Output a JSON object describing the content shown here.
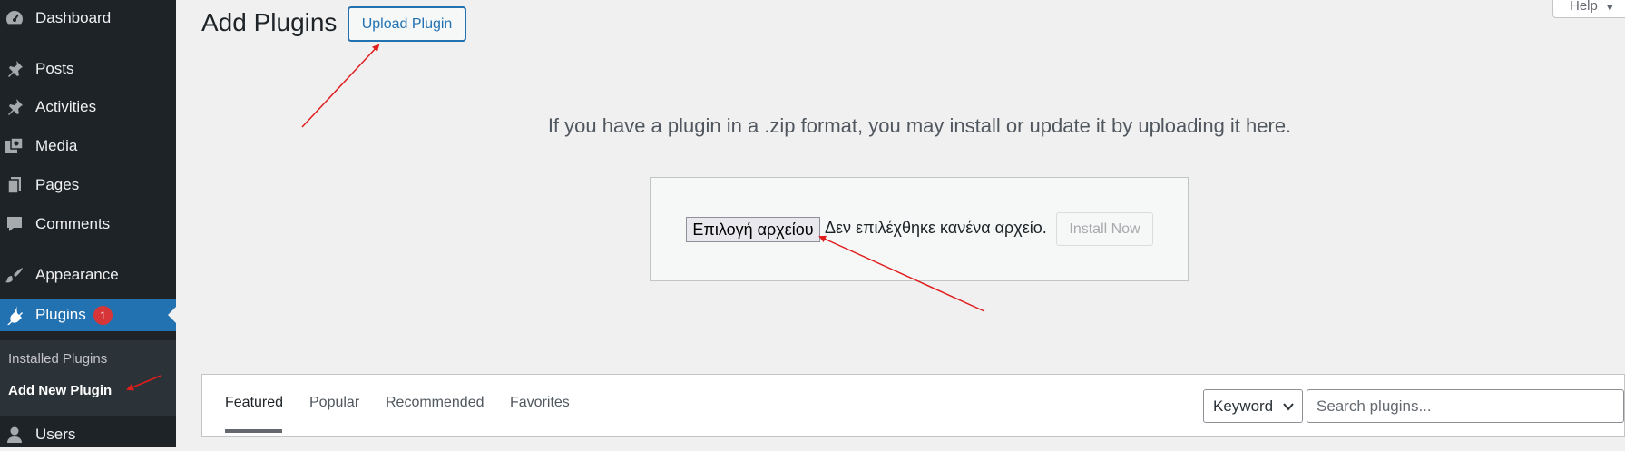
{
  "sidebar": {
    "items": [
      {
        "label": "Dashboard",
        "icon": "dashboard-icon"
      },
      {
        "label": "Posts",
        "icon": "pin-icon"
      },
      {
        "label": "Activities",
        "icon": "pin-icon"
      },
      {
        "label": "Media",
        "icon": "media-icon"
      },
      {
        "label": "Pages",
        "icon": "pages-icon"
      },
      {
        "label": "Comments",
        "icon": "comments-icon"
      },
      {
        "label": "Appearance",
        "icon": "paintbrush-icon"
      },
      {
        "label": "Plugins",
        "icon": "plugins-icon",
        "badge": "1"
      },
      {
        "label": "Users",
        "icon": "users-icon"
      }
    ],
    "submenu": [
      {
        "label": "Installed Plugins"
      },
      {
        "label": "Add New Plugin"
      }
    ]
  },
  "header": {
    "title": "Add Plugins",
    "upload_button": "Upload Plugin",
    "help_tab": "Help"
  },
  "upload": {
    "intro": "If you have a plugin in a .zip format, you may install or update it by uploading it here.",
    "choose_file": "Επιλογή αρχείου",
    "no_file": "Δεν επιλέχθηκε κανένα αρχείο.",
    "install_now": "Install Now"
  },
  "filters": {
    "tabs": [
      {
        "label": "Featured"
      },
      {
        "label": "Popular"
      },
      {
        "label": "Recommended"
      },
      {
        "label": "Favorites"
      }
    ],
    "search_type": "Keyword",
    "search_placeholder": "Search plugins..."
  },
  "colors": {
    "sidebar_bg": "#1d2327",
    "submenu_bg": "#2c3338",
    "accent": "#2271b1",
    "badge": "#d63638",
    "annotation_arrow": "#e01e1e",
    "page_bg": "#f0f0f1"
  }
}
